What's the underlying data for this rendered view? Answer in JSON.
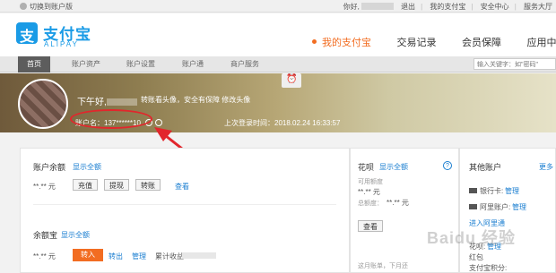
{
  "topbar": {
    "switch_label": "切换到账户版",
    "greeting": "你好,",
    "logout": "退出",
    "my_alipay": "我的支付宝",
    "security": "安全中心",
    "service": "服务大厅"
  },
  "header": {
    "brand": "支付宝",
    "brand_sub": "ALIPAY",
    "nav": [
      "我的支付宝",
      "交易记录",
      "会员保障",
      "应用中"
    ]
  },
  "subnav": {
    "tabs": [
      "首页",
      "账户资产",
      "账户设置",
      "账户通",
      "商户服务"
    ],
    "search_placeholder": "输入关键字：如\"密码\""
  },
  "banner": {
    "greeting": "下午好,",
    "tip": "转账看头像，安全有保障 修改头像",
    "account_label": "账户名：",
    "account_value": "137******10",
    "last_login_label": "上次登录时间：",
    "last_login_time": "2018.02.24 16:33:57"
  },
  "balance": {
    "title": "账户余额",
    "show_all": "显示全额",
    "amount": "**.** 元",
    "buttons": [
      "充值",
      "提现",
      "转账"
    ],
    "view": "查看"
  },
  "yuebao": {
    "title": "余额宝",
    "show_all": "显示全额",
    "amount": "**.** 元",
    "transfer_in": "转入",
    "transfer_out": "转出",
    "manage": "管理",
    "income": "累计收益"
  },
  "huabei": {
    "title": "花呗",
    "show_all": "显示全额",
    "available_label": "可用额度",
    "available": "**.** 元",
    "total_label": "总额度：",
    "total": "**.** 元",
    "view": "查看",
    "repayment": "这月账单，下月还",
    "help": "?"
  },
  "other": {
    "title": "其他账户",
    "more": "更多",
    "bank_card": "银行卡: ",
    "bank_manage": "管理",
    "ali_account": "阿里账户: ",
    "ali_manage": "管理",
    "open_link": "进入阿里通",
    "huabei_label": "花呗: ",
    "huabei_manage": "管理",
    "redpacket": "红包",
    "points": "支付宝积分: "
  },
  "watermark": "Baidu 经验"
}
